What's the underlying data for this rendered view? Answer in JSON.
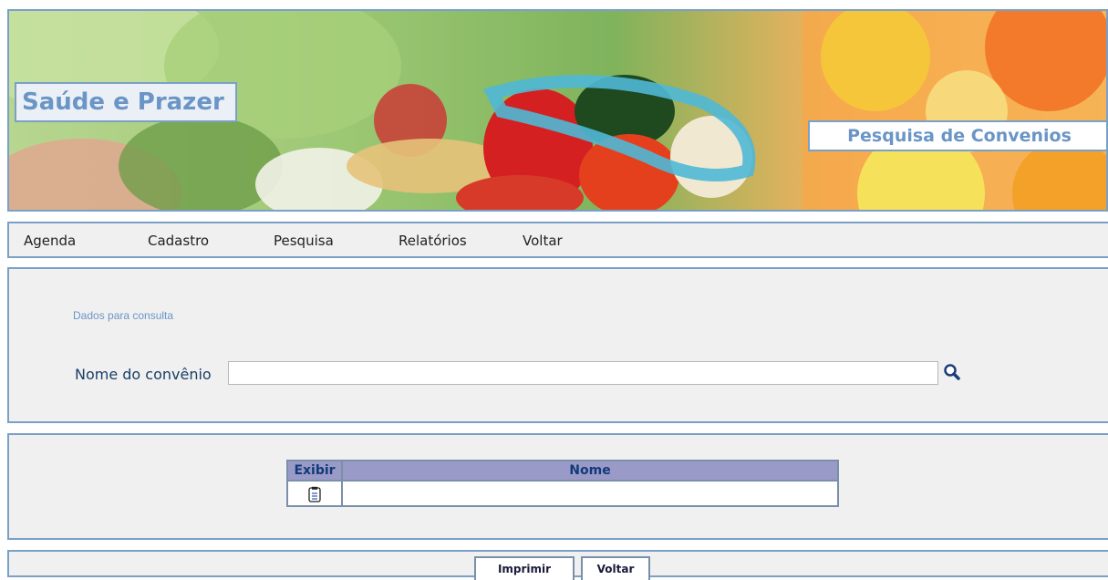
{
  "banner": {
    "site_title": "Saúde e Prazer",
    "page_title": "Pesquisa de Convenios"
  },
  "menu": {
    "items": [
      {
        "label": "Agenda"
      },
      {
        "label": "Cadastro"
      },
      {
        "label": "Pesquisa"
      },
      {
        "label": "Relatórios"
      },
      {
        "label": "Voltar"
      }
    ]
  },
  "search": {
    "section_label": "Dados para consulta",
    "field_label": "Nome do convênio",
    "field_value": "",
    "search_icon": "magnifier-icon"
  },
  "results": {
    "columns": [
      "Exibir",
      "Nome"
    ],
    "rows": [
      {
        "exibir_icon": "document-icon",
        "nome": ""
      }
    ]
  },
  "footer": {
    "print_label": "Imprimir",
    "back_label": "Voltar"
  },
  "colors": {
    "accent_blue": "#6a95c6",
    "border_blue": "#7aa0c8",
    "table_header": "#9a9ac8",
    "panel_bg": "#f0f0f0"
  }
}
